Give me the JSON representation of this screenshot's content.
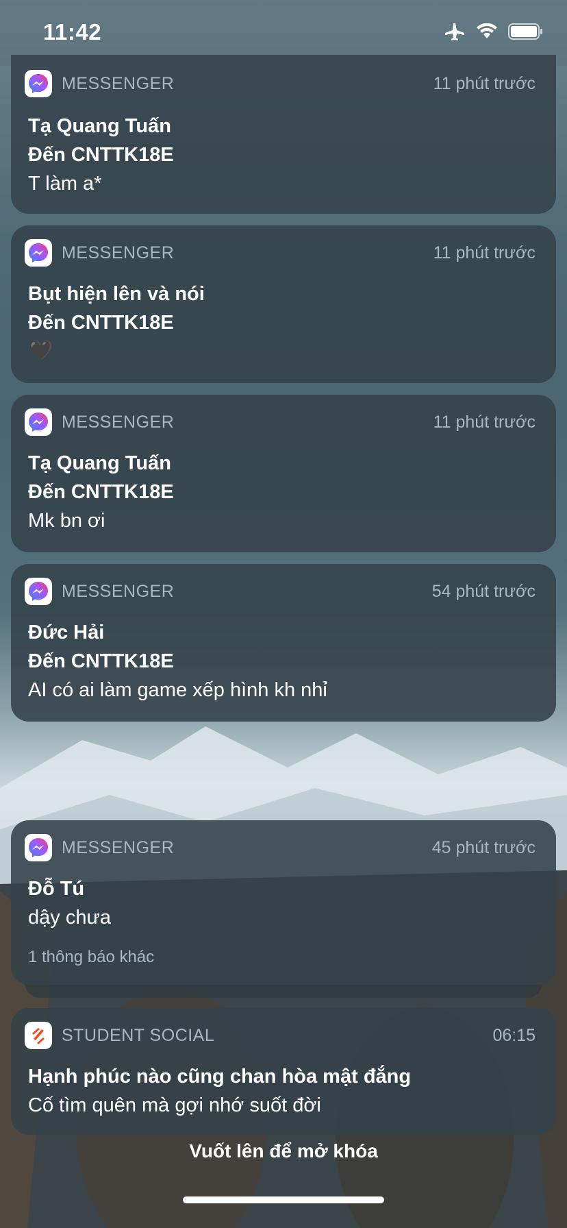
{
  "status_bar": {
    "time": "11:42"
  },
  "notifications": [
    {
      "app": "MESSENGER",
      "time": "11 phút trước",
      "title": "Tạ Quang Tuấn",
      "subtitle": "Đến CNTTK18E",
      "body": "T làm a*"
    },
    {
      "app": "MESSENGER",
      "time": "11 phút trước",
      "title": "Bụt hiện lên và nói",
      "subtitle": "Đến CNTTK18E",
      "body": "🖤"
    },
    {
      "app": "MESSENGER",
      "time": "11 phút trước",
      "title": "Tạ Quang Tuấn",
      "subtitle": "Đến CNTTK18E",
      "body": "Mk bn ơi"
    },
    {
      "app": "MESSENGER",
      "time": "54 phút trước",
      "title": "Đức Hải",
      "subtitle": "Đến CNTTK18E",
      "body": "AI có ai làm game xếp hình kh nhỉ"
    },
    {
      "app": "MESSENGER",
      "time": "45 phút trước",
      "title": "Đỗ Tú",
      "body": "dậy chưa",
      "more": "1 thông báo khác"
    },
    {
      "app": "STUDENT SOCIAL",
      "time": "06:15",
      "title": "Hạnh phúc nào cũng chan hòa mật đắng",
      "body": "Cố tìm quên mà gợi nhớ suốt đời"
    }
  ],
  "lock_hint": "Vuốt lên để mở khóa",
  "colors": {
    "messenger_gradient": [
      "#3b82f6",
      "#a855f7",
      "#f43f5e"
    ],
    "student_social": "#f04e23"
  },
  "icons": [
    "airplane-icon",
    "wifi-icon",
    "battery-icon",
    "messenger-icon",
    "student-social-icon"
  ]
}
